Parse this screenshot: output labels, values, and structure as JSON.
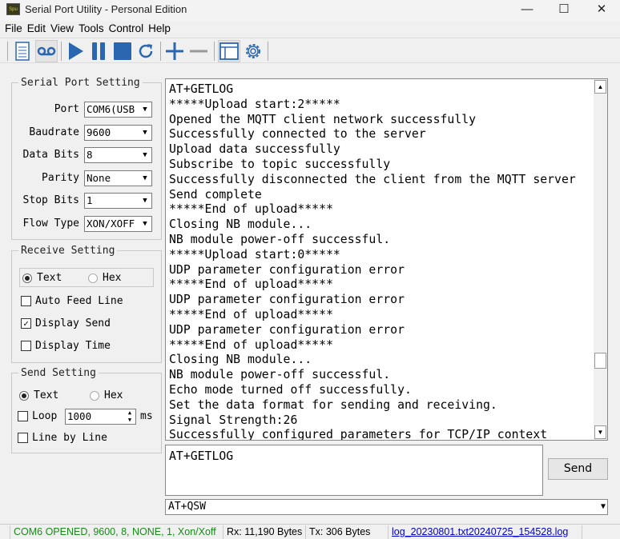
{
  "window": {
    "title": "Serial Port Utility - Personal Edition",
    "icon_text": "Spu"
  },
  "menu": [
    "File",
    "Edit",
    "View",
    "Tools",
    "Control",
    "Help"
  ],
  "toolbar": [
    "new-document-icon",
    "record-icon",
    "play-icon",
    "pause-icon",
    "stop-icon",
    "refresh-icon",
    "add-icon",
    "remove-icon",
    "window-icon",
    "gear-icon"
  ],
  "serial": {
    "title": "Serial Port Setting",
    "fields": [
      {
        "label": "Port",
        "value": "COM6(USB"
      },
      {
        "label": "Baudrate",
        "value": "9600"
      },
      {
        "label": "Data Bits",
        "value": "8"
      },
      {
        "label": "Parity",
        "value": "None"
      },
      {
        "label": "Stop Bits",
        "value": "1"
      },
      {
        "label": "Flow Type",
        "value": "XON/XOFF"
      }
    ]
  },
  "receive": {
    "title": "Receive Setting",
    "text": "Text",
    "hex": "Hex",
    "mode": "Text",
    "auto_feed": "Auto Feed Line",
    "auto_feed_checked": false,
    "display_send": "Display Send",
    "display_send_checked": true,
    "display_time": "Display Time",
    "display_time_checked": false
  },
  "send": {
    "title": "Send Setting",
    "text": "Text",
    "hex": "Hex",
    "mode": "Text",
    "loop": "Loop",
    "loop_checked": false,
    "loop_value": "1000",
    "loop_unit": "ms",
    "line_by_line": "Line by Line",
    "line_by_line_checked": false
  },
  "receive_lines": [
    "AT+GETLOG",
    "*****Upload start:2*****",
    "Opened the MQTT client network successfully",
    "Successfully connected to the server",
    "Upload data successfully",
    "Subscribe to topic successfully",
    "Successfully disconnected the client from the MQTT server",
    "Send complete",
    "*****End of upload*****",
    "Closing NB module...",
    "NB module power-off successful.",
    "*****Upload start:0*****",
    "UDP parameter configuration error",
    "*****End of upload*****",
    "UDP parameter configuration error",
    "*****End of upload*****",
    "UDP parameter configuration error",
    "*****End of upload*****",
    "Closing NB module...",
    "NB module power-off successful.",
    "Echo mode turned off successfully.",
    "Set the data format for sending and receiving.",
    "Signal Strength:26",
    "Successfully configured parameters for TCP/IP context"
  ],
  "send_input": "AT+GETLOG",
  "send_button": "Send",
  "command_combo": "AT+QSW",
  "status": {
    "connection": "COM6 OPENED, 9600, 8, NONE, 1, Xon/Xoff",
    "rx": "Rx: 11,190 Bytes",
    "tx": "Tx: 306 Bytes",
    "log": "log_20230801.txt20240725_154528.log",
    "connection_color": "#1a8a1a",
    "log_color": "#0000cc"
  }
}
